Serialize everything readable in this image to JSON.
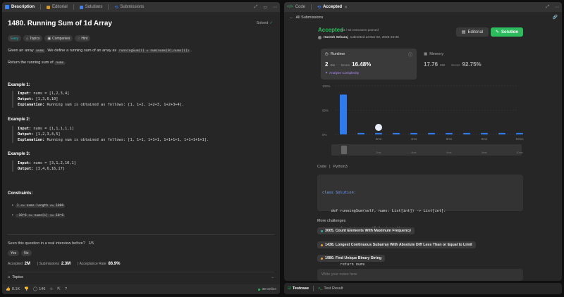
{
  "left_tabs": [
    {
      "label": "Description"
    },
    {
      "label": "Editorial"
    },
    {
      "label": "Solutions"
    },
    {
      "label": "Submissions"
    }
  ],
  "problem": {
    "title": "1480. Running Sum of 1d Array",
    "status": "Solved",
    "difficulty": "Easy",
    "tags": [
      "Topics",
      "Companies",
      "Hint"
    ],
    "desc_pre": "Given an array ",
    "desc_code1": "nums",
    "desc_mid": ". We define a running sum of an array as ",
    "desc_code2": "runningSum[i] = sum(nums[0]…nums[i])",
    "desc_end": ".",
    "desc2_pre": "Return the running sum of ",
    "desc2_code": "nums",
    "desc2_end": ".",
    "examples": [
      {
        "heading": "Example 1:",
        "input": "nums = [1,2,3,4]",
        "output": "[1,3,6,10]",
        "explanation": "Running sum is obtained as follows: [1, 1+2, 1+2+3, 1+2+3+4]."
      },
      {
        "heading": "Example 2:",
        "input": "nums = [1,1,1,1,1]",
        "output": "[1,2,3,4,5]",
        "explanation": "Running sum is obtained as follows: [1, 1+1, 1+1+1, 1+1+1+1, 1+1+1+1+1]."
      },
      {
        "heading": "Example 3:",
        "input": "nums = [3,1,2,10,1]",
        "output": "[3,4,6,16,17]",
        "explanation": ""
      }
    ],
    "labels": {
      "input": "Input:",
      "output": "Output:",
      "explanation": "Explanation:"
    },
    "constraints_heading": "Constraints:",
    "constraints": [
      "1 <= nums.length <= 1000",
      "-10^6 <= nums[i] <= 10^6"
    ],
    "interview_q": "Seen this question in a real interview before?",
    "interview_count": "1/5",
    "yes": "Yes",
    "no": "No",
    "accepted_label": "Accepted",
    "accepted": "2M",
    "submissions_label": "Submissions",
    "submissions": "2.3M",
    "rate_label": "Acceptance Rate",
    "rate": "86.9%",
    "topics": "Topics"
  },
  "footer": {
    "likes": "8.1K",
    "comments": "146",
    "online": "39 Online"
  },
  "right_tabs": [
    {
      "label": "Code"
    },
    {
      "label": "Accepted"
    }
  ],
  "sub": {
    "back": "All Submissions",
    "status": "Accepted",
    "passed": "54 / 54 testcases passed",
    "user": "Haresh Sekaraj",
    "submitted": "submitted at Mar 02, 2025 23:36",
    "editorial_btn": "Editorial",
    "solution_btn": "Solution",
    "runtime_label": "Runtime",
    "runtime_val": "2",
    "runtime_unit": "ms",
    "beats": "Beats",
    "runtime_beats": "16.48%",
    "analyze": "Analyze Complexity",
    "memory_label": "Memory",
    "memory_val": "17.76",
    "memory_unit": "MB",
    "memory_beats": "92.75%",
    "code_label": "Code",
    "lang": "Python3",
    "code_lines": [
      "class Solution:",
      "    def runningSum(self, nums: List[int]) -> List[int]:",
      "        for i in range(1,len(nums)):",
      "            nums[i]+=nums[i-1]",
      "        return nums"
    ],
    "more": "More challenges",
    "challenges": [
      "3005. Count Elements With Maximum Frequency",
      "1438. Longest Continuous Subarray With Absolute Diff Less Than or Equal to Limit",
      "1980. Find Unique Binary String"
    ],
    "notes_placeholder": "Write your notes here"
  },
  "chart_data": {
    "type": "bar",
    "y_ticks": [
      "100%",
      "50%",
      "0%"
    ],
    "x_labels": [
      "2ms",
      "4ms",
      "6ms",
      "8ms",
      "10ms"
    ],
    "values": [
      82,
      3,
      3,
      3,
      3,
      3,
      3,
      3,
      3,
      3,
      3
    ],
    "ylim": [
      0,
      100
    ]
  },
  "bottom_tabs": [
    {
      "label": "Testcase"
    },
    {
      "label": "Test Result"
    }
  ]
}
